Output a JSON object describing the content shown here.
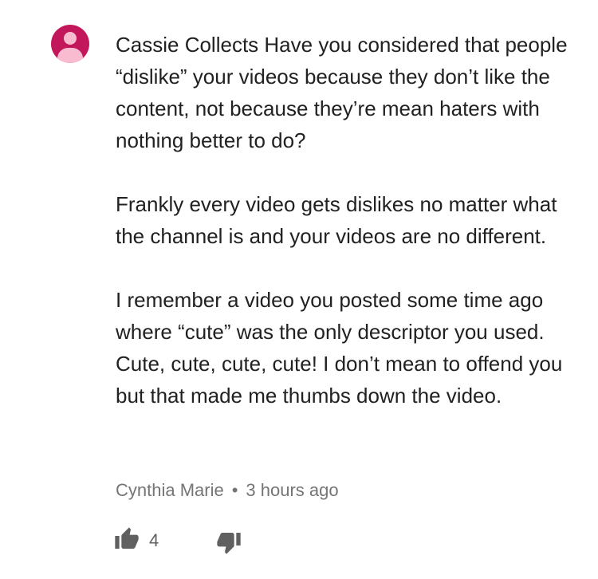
{
  "comment": {
    "paragraphs": [
      "Cassie Collects Have you considered that people “dislike” your videos because they don’t like the content, not because they’re mean haters with nothing better to do?",
      "Frankly every video gets dislikes no matter what the channel is and your videos are no different.",
      "I remember a video you posted some time ago where “cute” was the only descriptor you used. Cute, cute, cute, cute! I don’t mean to offend you but that made me thumbs down the video."
    ],
    "author": "Cynthia Marie",
    "separator": "•",
    "timestamp": "3 hours ago",
    "like_count": "4"
  },
  "icons": {
    "avatar": "default-avatar-icon",
    "like": "thumb-up-icon",
    "dislike": "thumb-down-icon"
  },
  "colors": {
    "avatar_bg": "#c2185b",
    "avatar_fg": "#f8bbd0",
    "text": "#212121",
    "meta_text": "#757575",
    "icon": "#606060"
  }
}
